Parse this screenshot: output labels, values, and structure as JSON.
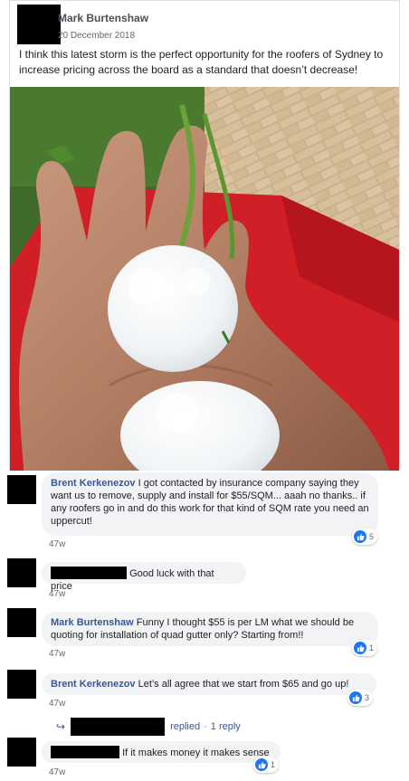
{
  "post": {
    "author": "Mark Burtenshaw",
    "date": "20 December 2018",
    "text": "I think this latest storm is the perfect opportunity for the roofers of Sydney to increase pricing across the board as a standard that doesn’t decrease!"
  },
  "comments": [
    {
      "author": "Brent Kerkenezov",
      "text": "I got contacted by insurance company saying they want us to remove, supply and install for $55/SQM... aaah no thanks.. if any roofers go in and do this work for that kind of SQM rate you need an uppercut!",
      "time": "47w",
      "reactions": "5"
    },
    {
      "author": "",
      "text": "Good luck with that price",
      "time": "47w",
      "reactions": ""
    },
    {
      "author": "Mark Burtenshaw",
      "text": "Funny I thought $55 is per LM what we should be quoting for installation of quad gutter only? Starting from!!",
      "time": "47w",
      "reactions": "1"
    },
    {
      "author": "Brent Kerkenezov",
      "text": "Let’s all agree that we start from $65 and go up!",
      "time": "47w",
      "reactions": "3"
    },
    {
      "author": "",
      "text": "If it makes money it makes sense",
      "time": "47w",
      "reactions": "1"
    }
  ],
  "replies": {
    "label": "replied",
    "count_label": "1 reply",
    "separator": "·",
    "icon": "reply-arrow-icon"
  },
  "colors": {
    "name_link": "#385898",
    "bubble": "#f2f3f5",
    "like": "#1877f2"
  }
}
